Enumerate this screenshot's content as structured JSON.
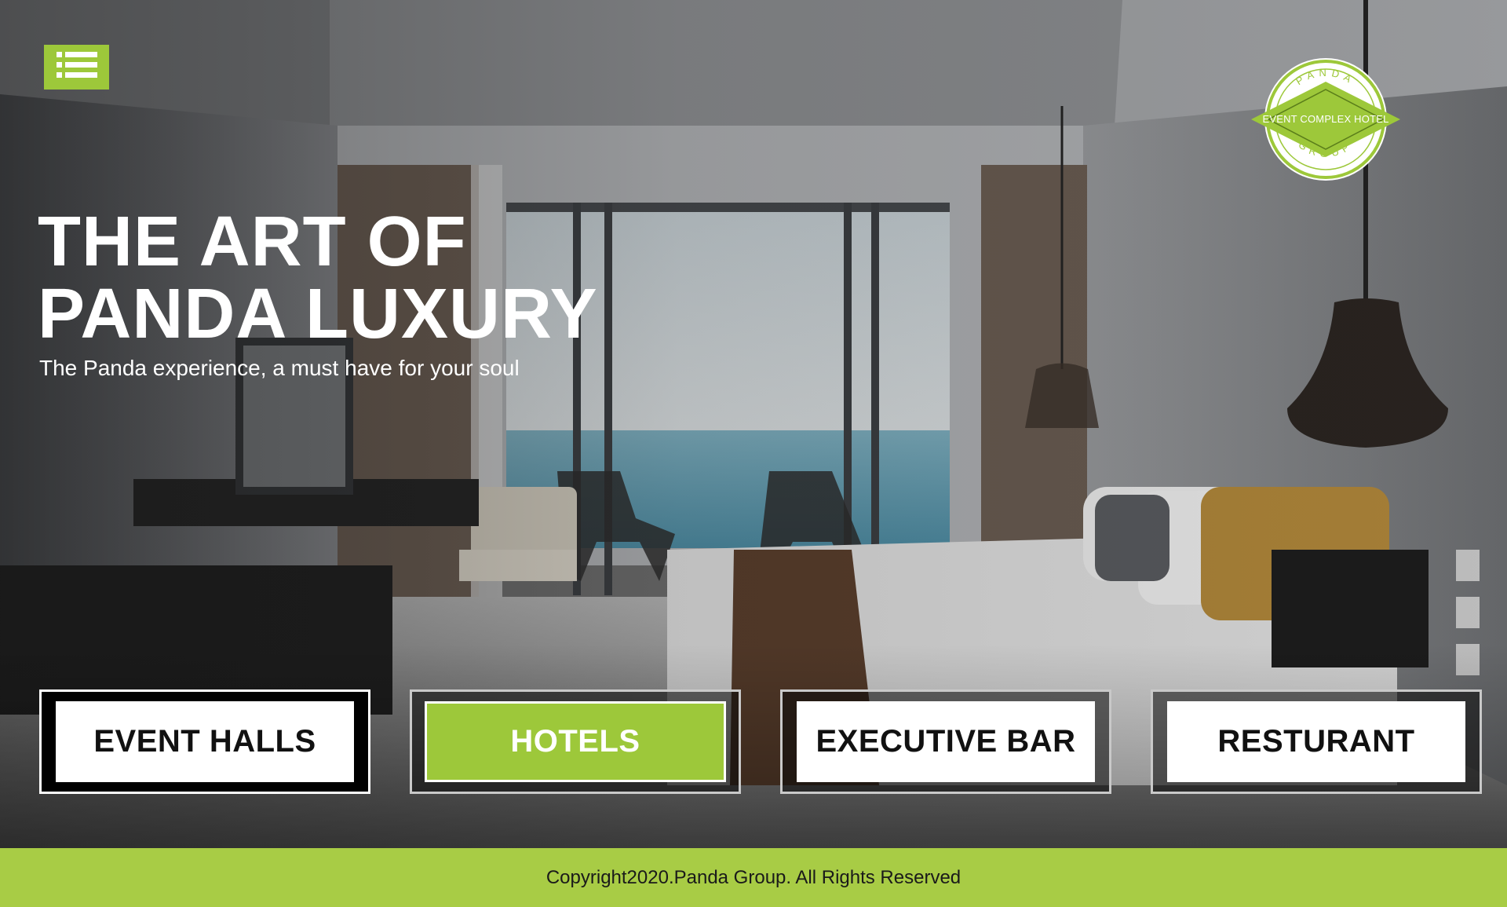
{
  "header": {
    "menu_icon": "list-icon",
    "logo": {
      "top_text": "PANDA",
      "center_text": "EVENT COMPLEX HOTEL",
      "bottom_text": "GROUP"
    }
  },
  "hero": {
    "title_line1": "THE ART OF",
    "title_line2": "PANDA LUXURY",
    "subtitle": "The Panda experience, a must have for your soul"
  },
  "categories": [
    {
      "label": "EVENT HALLS",
      "active": false
    },
    {
      "label": "HOTELS",
      "active": true
    },
    {
      "label": "EXECUTIVE BAR",
      "active": false
    },
    {
      "label": "RESTURANT",
      "active": false
    }
  ],
  "footer": {
    "copyright": "Copyright2020.Panda Group. All Rights Reserved"
  },
  "colors": {
    "accent": "#9dc83a",
    "footer_bg": "#a8cc45",
    "text_light": "#ffffff",
    "text_dark": "#111111"
  }
}
